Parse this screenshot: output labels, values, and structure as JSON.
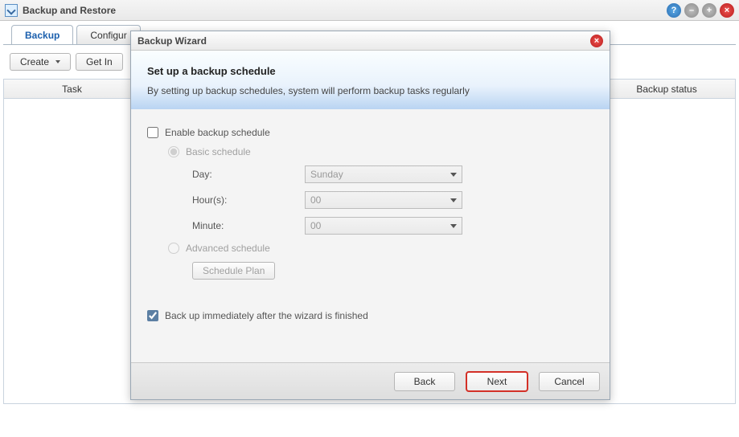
{
  "window": {
    "title": "Backup and Restore",
    "buttons": {
      "help": "?",
      "minimize": "–",
      "maximize": "+",
      "close": "×"
    }
  },
  "tabs": {
    "backup": "Backup",
    "config": "Configur"
  },
  "toolbar": {
    "create": "Create",
    "getinfo": "Get In"
  },
  "columns": {
    "task": "Task",
    "mid": "",
    "status": "Backup status"
  },
  "wizard": {
    "title": "Backup Wizard",
    "close": "×",
    "heading": "Set up a backup schedule",
    "sub": "By setting up backup schedules, system will perform backup tasks regularly",
    "enable_label": "Enable backup schedule",
    "basic_label": "Basic schedule",
    "day_label": "Day:",
    "day_value": "Sunday",
    "hour_label": "Hour(s):",
    "hour_value": "00",
    "minute_label": "Minute:",
    "minute_value": "00",
    "advanced_label": "Advanced schedule",
    "schedule_plan": "Schedule Plan",
    "immediate_label": "Back up immediately after the wizard is finished",
    "back": "Back",
    "next": "Next",
    "cancel": "Cancel"
  }
}
